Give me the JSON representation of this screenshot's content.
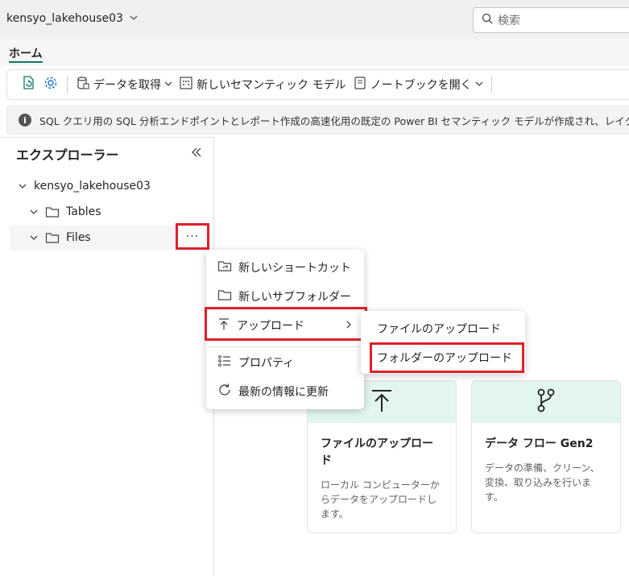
{
  "header": {
    "workspace_name": "kensyo_lakehouse03",
    "search_placeholder": "検索"
  },
  "tabs": {
    "home": "ホーム"
  },
  "ribbon": {
    "get_data": "データを取得",
    "new_semantic_model": "新しいセマンティック モデル",
    "open_notebook": "ノートブックを開く"
  },
  "banner": {
    "text": "SQL クエリ用の SQL 分析エンドポイントとレポート作成の高速化用の既定の Power BI セマンティック モデルが作成され、レイクハウス"
  },
  "explorer": {
    "title": "エクスプローラー",
    "root": "kensyo_lakehouse03",
    "tables": "Tables",
    "files": "Files",
    "more": "···"
  },
  "context_menu": {
    "new_shortcut": "新しいショートカット",
    "new_subfolder": "新しいサブフォルダー",
    "upload": "アップロード",
    "properties": "プロパティ",
    "refresh": "最新の情報に更新"
  },
  "upload_submenu": {
    "upload_files": "ファイルのアップロード",
    "upload_folder": "フォルダーのアップロード"
  },
  "cards": [
    {
      "title": "ファイルのアップロード",
      "desc": "ローカル コンピューターからデータをアップロードします。"
    },
    {
      "title": "データ フロー Gen2",
      "desc": "データの準備、クリーン、変換、取り込みを行います。"
    }
  ],
  "colors": {
    "accent": "#117865",
    "highlight": "#e0202a",
    "card_header": "#e3f5ef"
  }
}
